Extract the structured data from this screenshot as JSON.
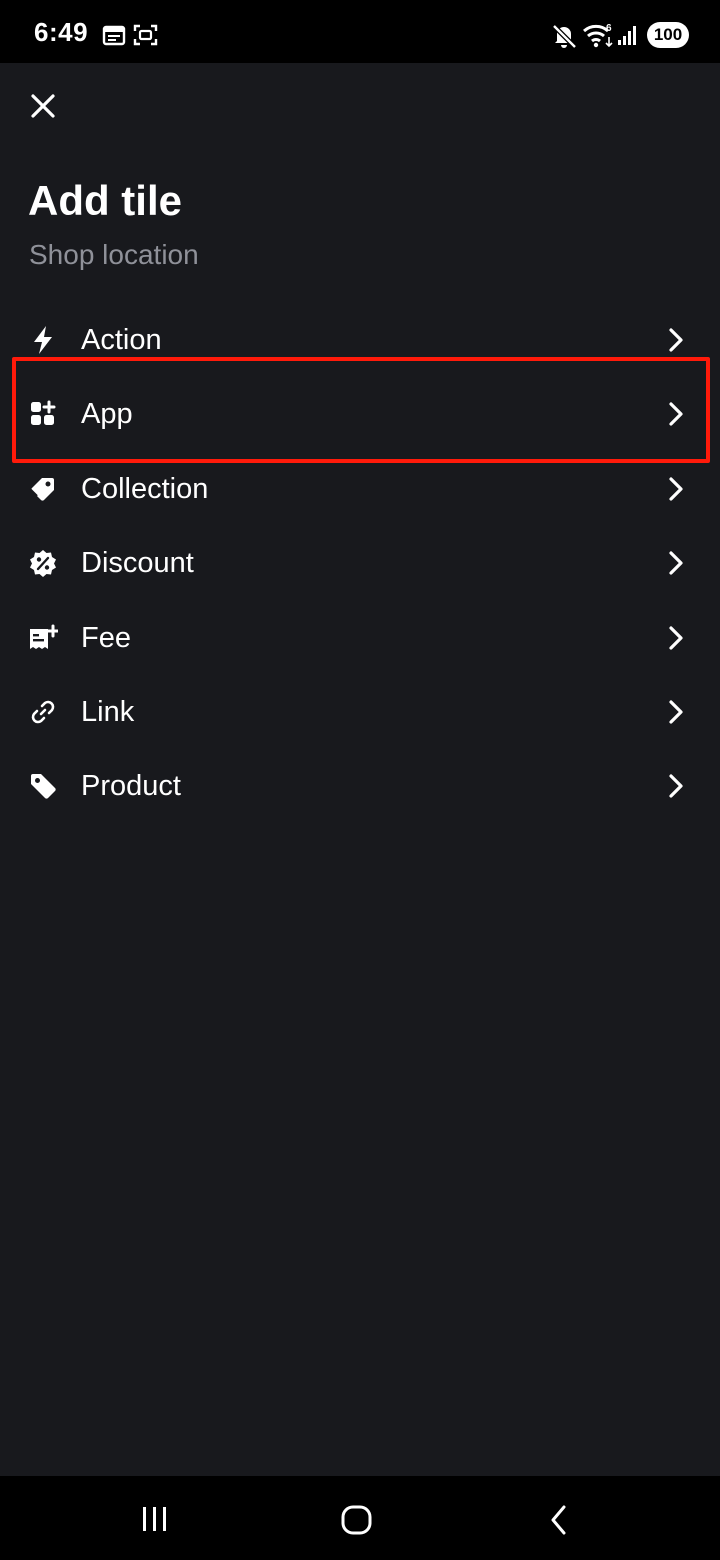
{
  "status_bar": {
    "time": "6:49",
    "battery": "100",
    "icons": [
      "calendar-icon",
      "screenshot-icon",
      "mute-icon",
      "wifi-icon",
      "signal-icon",
      "battery-icon"
    ]
  },
  "header": {
    "close_icon": "close-icon",
    "title": "Add tile",
    "subtitle": "Shop location"
  },
  "menu": {
    "items": [
      {
        "label": "Action",
        "icon": "lightning-icon"
      },
      {
        "label": "App",
        "icon": "apps-icon",
        "highlighted": true
      },
      {
        "label": "Collection",
        "icon": "tags-icon"
      },
      {
        "label": "Discount",
        "icon": "discount-icon"
      },
      {
        "label": "Fee",
        "icon": "fee-icon"
      },
      {
        "label": "Link",
        "icon": "link-icon"
      },
      {
        "label": "Product",
        "icon": "tag-icon"
      }
    ]
  },
  "colors": {
    "background": "#18191d",
    "subtitle": "#8f9199",
    "highlight": "#ff1a0a"
  },
  "nav_bar": {
    "buttons": [
      "recents-icon",
      "home-icon",
      "back-icon"
    ]
  }
}
